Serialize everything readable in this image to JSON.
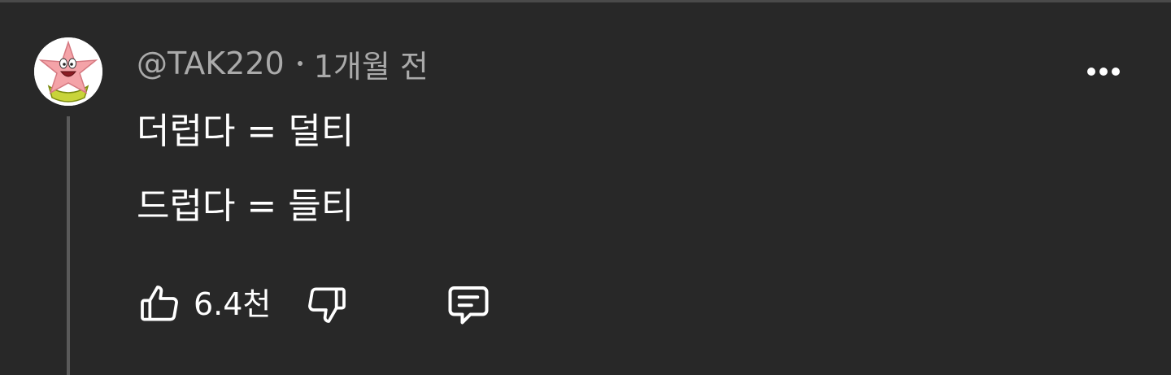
{
  "comment": {
    "author": "@TAK220",
    "time": "1개월 전",
    "lines": [
      "더럽다 = 덜티",
      "드럽다 = 들티"
    ],
    "like_count": "6.4천"
  },
  "icons": {
    "avatar": "patrick-star-avatar",
    "more": "more-vert-icon",
    "like": "thumbs-up-icon",
    "dislike": "thumbs-down-icon",
    "reply": "comment-icon"
  },
  "colors": {
    "background": "#282828",
    "meta_text": "#aaaaaa",
    "text": "#ffffff",
    "thread_line": "#5a5a5a"
  }
}
